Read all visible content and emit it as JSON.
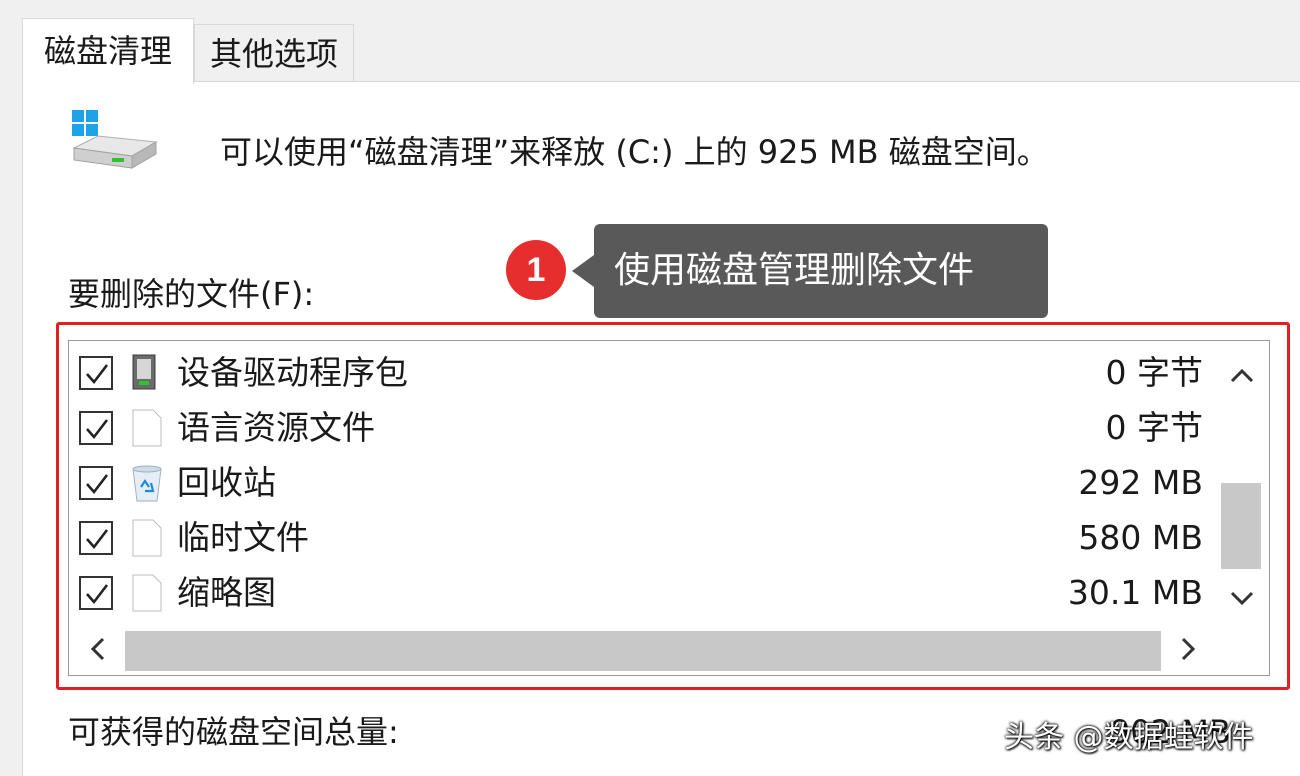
{
  "tabs": [
    {
      "label": "磁盘清理",
      "active": true
    },
    {
      "label": "其他选项",
      "active": false
    }
  ],
  "summary": "可以使用“磁盘清理”来释放 (C:) 上的 925 MB 磁盘空间。",
  "files_label": "要删除的文件(F):",
  "annotation": {
    "badge": "1",
    "text": "使用磁盘管理删除文件",
    "color": "#e62e2e"
  },
  "file_list": [
    {
      "label": "设备驱动程序包",
      "size": "0 字节",
      "checked": true,
      "icon": "driver-package-icon"
    },
    {
      "label": "语言资源文件",
      "size": "0 字节",
      "checked": true,
      "icon": "file-icon"
    },
    {
      "label": "回收站",
      "size": "292 MB",
      "checked": true,
      "icon": "recycle-bin-icon"
    },
    {
      "label": "临时文件",
      "size": "580 MB",
      "checked": true,
      "icon": "file-icon"
    },
    {
      "label": "缩略图",
      "size": "30.1 MB",
      "checked": true,
      "icon": "file-icon"
    }
  ],
  "total_label": "可获得的磁盘空间总量:",
  "total_value": "902 MB",
  "watermark": "头条 @数据蛙软件"
}
